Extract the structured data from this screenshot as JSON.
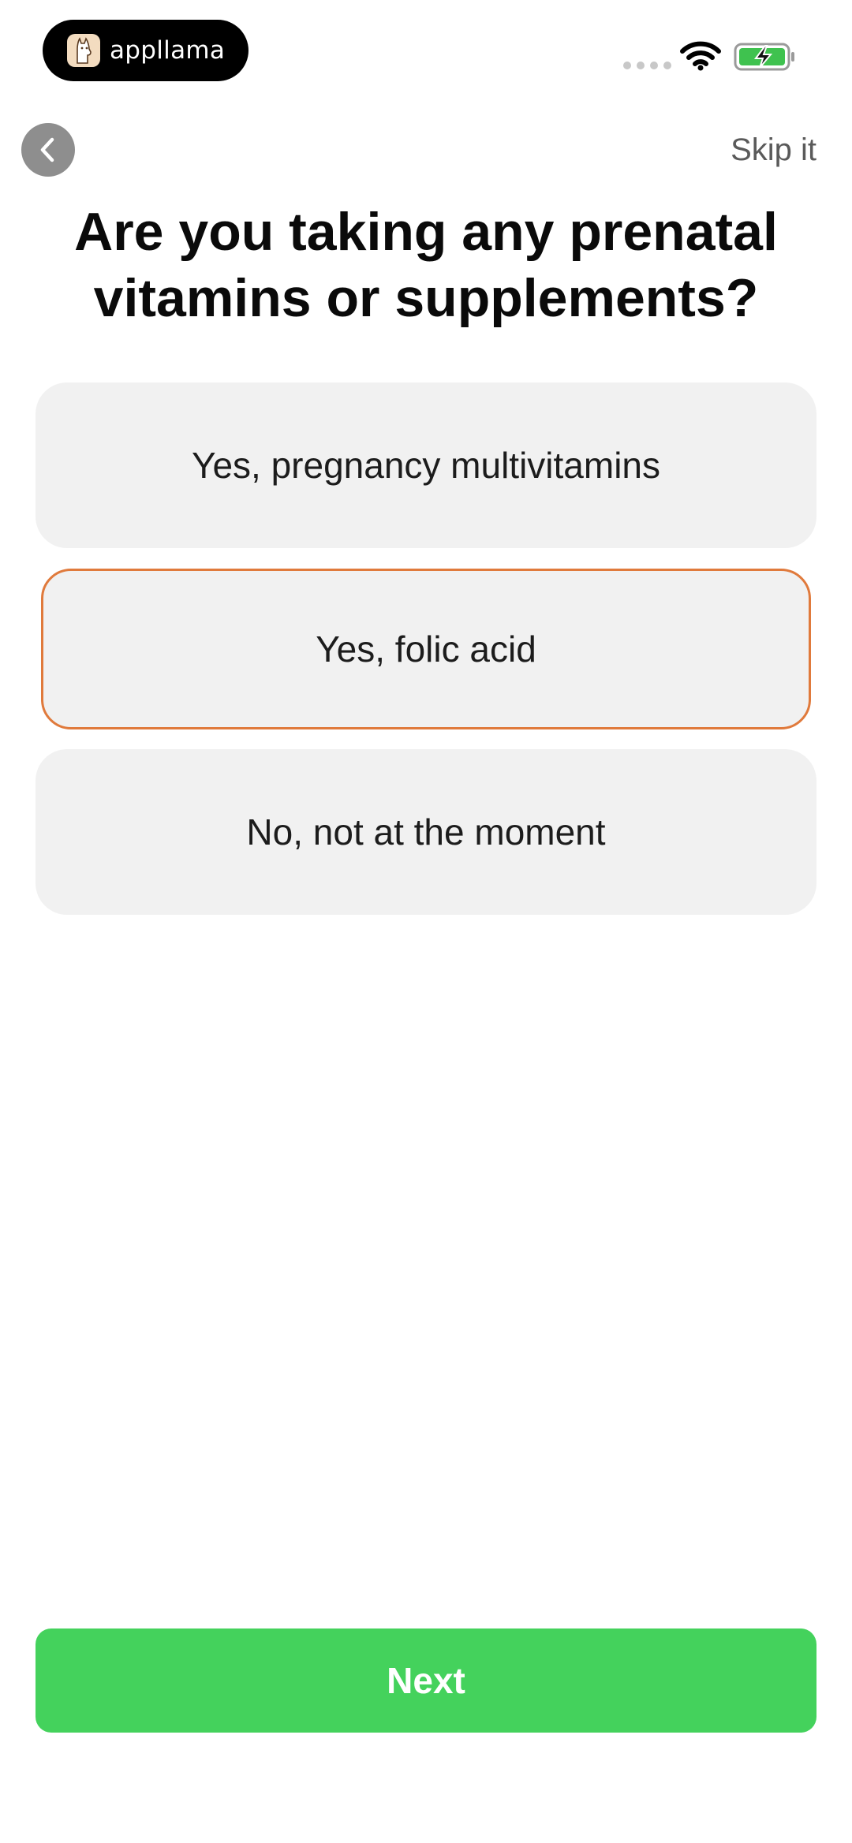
{
  "status_bar": {
    "app_badge_text": "appllama",
    "battery_color": "#3fc24f"
  },
  "nav": {
    "back_icon": "chevron-left-icon",
    "skip_label": "Skip it"
  },
  "question": {
    "line1": "Are you taking any prenatal",
    "line2": "vitamins or supplements?"
  },
  "options": [
    {
      "label": "Yes, pregnancy multivitamins",
      "selected": false
    },
    {
      "label": "Yes, folic acid",
      "selected": true
    },
    {
      "label": "No, not at the moment",
      "selected": false
    }
  ],
  "next_button": {
    "label": "Next"
  },
  "colors": {
    "accent_green": "#44d25c",
    "selected_border": "#e07a3c",
    "option_bg": "#f1f1f1"
  }
}
